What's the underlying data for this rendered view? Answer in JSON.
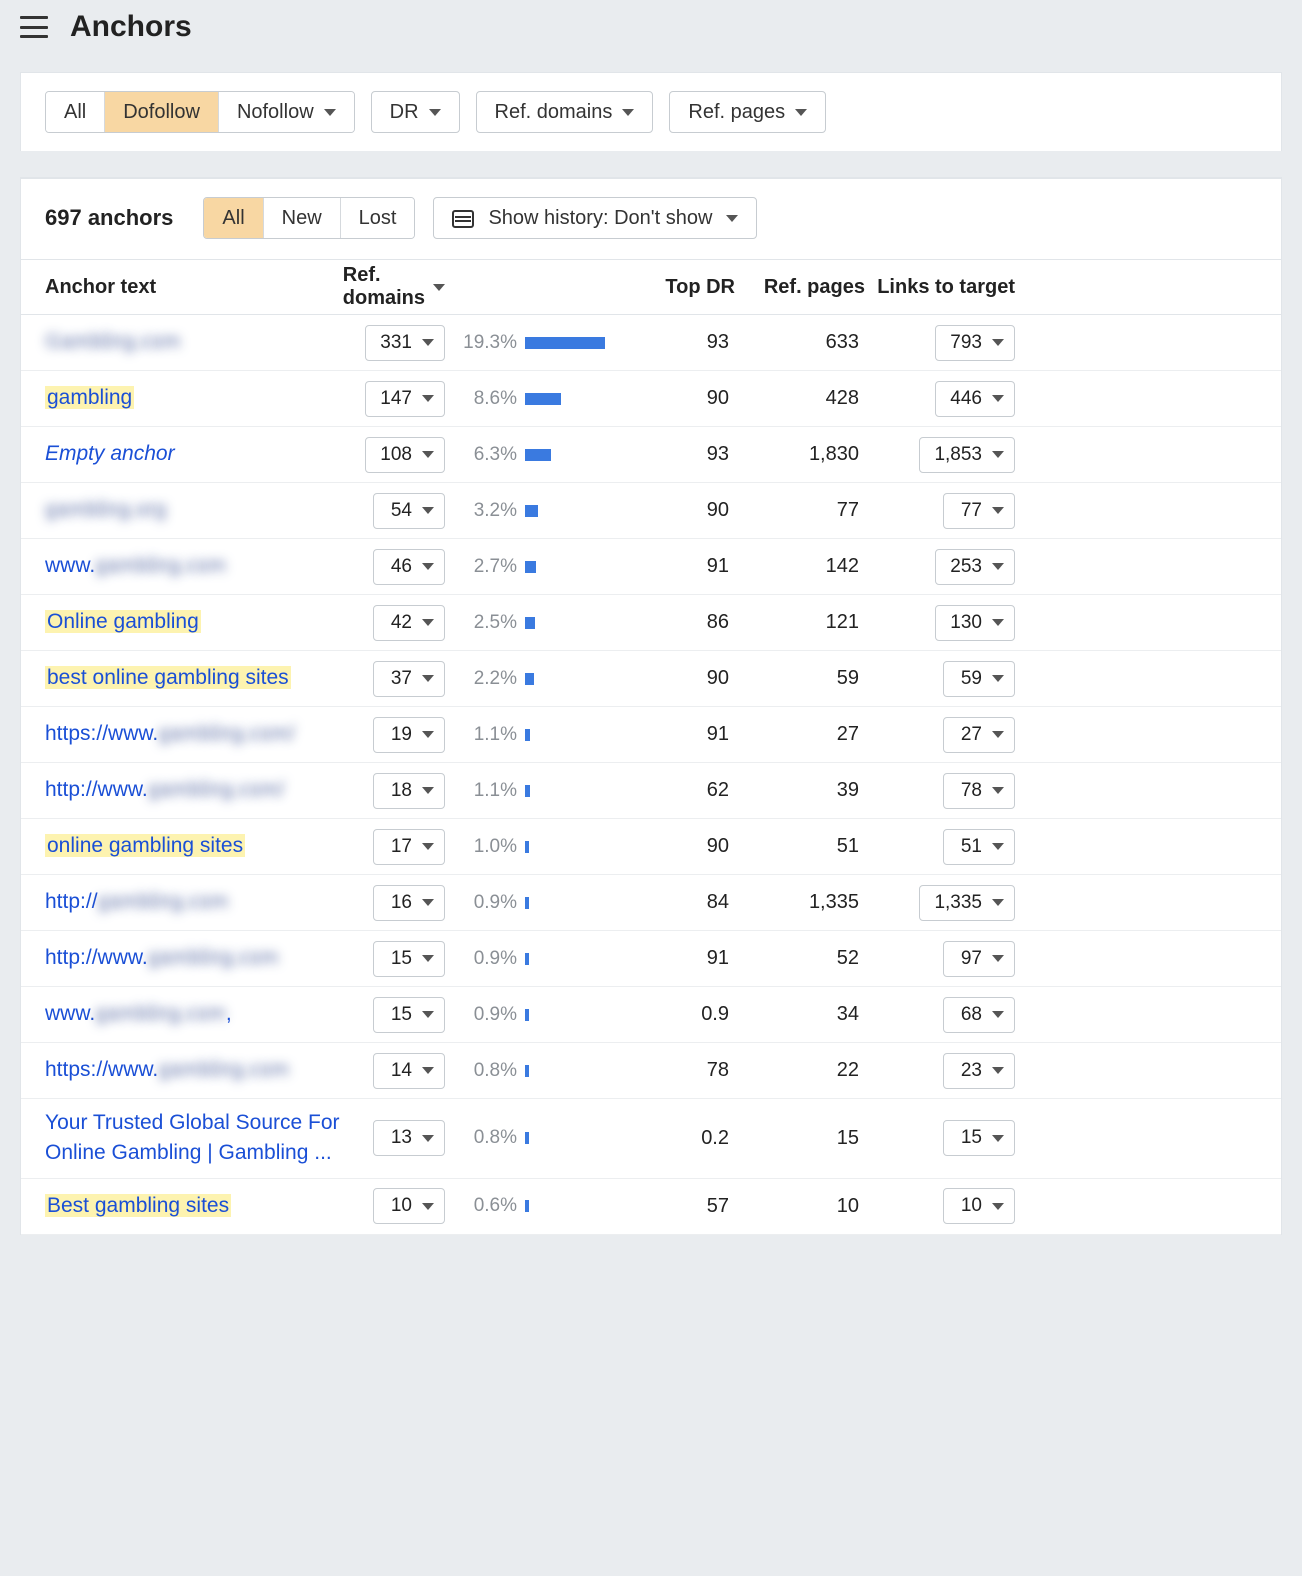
{
  "header": {
    "title": "Anchors"
  },
  "filters": {
    "follow": {
      "all": "All",
      "dofollow": "Dofollow",
      "nofollow": "Nofollow",
      "active": "dofollow"
    },
    "dr": "DR",
    "refdomains": "Ref. domains",
    "refpages": "Ref. pages"
  },
  "toolbar": {
    "count_text": "697 anchors",
    "group": {
      "all": "All",
      "new": "New",
      "lost": "Lost",
      "active": "all"
    },
    "history_label": "Show history: Don't show"
  },
  "columns": {
    "anchor": "Anchor text",
    "refdomains": "Ref. domains",
    "topdr": "Top DR",
    "refpages": "Ref. pages",
    "links": "Links to target"
  },
  "bar_max_pct": 19.3,
  "rows": [
    {
      "anchor": "Gambling.com",
      "highlight": false,
      "empty": false,
      "blurred": true,
      "ref_domains": "331",
      "pct": "19.3%",
      "bar_pct": 19.3,
      "top_dr": "93",
      "ref_pages": "633",
      "links": "793"
    },
    {
      "anchor": "gambling",
      "highlight": true,
      "empty": false,
      "blurred": false,
      "ref_domains": "147",
      "pct": "8.6%",
      "bar_pct": 8.6,
      "top_dr": "90",
      "ref_pages": "428",
      "links": "446"
    },
    {
      "anchor": "Empty anchor",
      "highlight": false,
      "empty": true,
      "blurred": false,
      "ref_domains": "108",
      "pct": "6.3%",
      "bar_pct": 6.3,
      "top_dr": "93",
      "ref_pages": "1,830",
      "links": "1,853"
    },
    {
      "anchor": "gambling.org",
      "highlight": false,
      "empty": false,
      "blurred": true,
      "ref_domains": "54",
      "pct": "3.2%",
      "bar_pct": 3.2,
      "top_dr": "90",
      "ref_pages": "77",
      "links": "77"
    },
    {
      "anchor_prefix": "www.",
      "anchor_blur": "gambling.com",
      "anchor": "www.gambling.com",
      "highlight": false,
      "empty": false,
      "blurred": false,
      "partial": true,
      "ref_domains": "46",
      "pct": "2.7%",
      "bar_pct": 2.7,
      "top_dr": "91",
      "ref_pages": "142",
      "links": "253"
    },
    {
      "anchor": "Online gambling",
      "highlight": true,
      "empty": false,
      "blurred": false,
      "ref_domains": "42",
      "pct": "2.5%",
      "bar_pct": 2.5,
      "top_dr": "86",
      "ref_pages": "121",
      "links": "130"
    },
    {
      "anchor": "best online gambling sites",
      "highlight": true,
      "empty": false,
      "blurred": false,
      "ref_domains": "37",
      "pct": "2.2%",
      "bar_pct": 2.2,
      "top_dr": "90",
      "ref_pages": "59",
      "links": "59"
    },
    {
      "anchor_prefix": "https://www.",
      "anchor_blur": "gambling.com/",
      "anchor": "https://www.gambling.com/",
      "highlight": false,
      "empty": false,
      "blurred": false,
      "partial": true,
      "ref_domains": "19",
      "pct": "1.1%",
      "bar_pct": 1.1,
      "top_dr": "91",
      "ref_pages": "27",
      "links": "27"
    },
    {
      "anchor_prefix": "http://www.",
      "anchor_blur": "gambling.com/",
      "anchor": "http://www.gambling.com/",
      "highlight": false,
      "empty": false,
      "blurred": false,
      "partial": true,
      "ref_domains": "18",
      "pct": "1.1%",
      "bar_pct": 1.1,
      "top_dr": "62",
      "ref_pages": "39",
      "links": "78"
    },
    {
      "anchor": "online gambling sites",
      "highlight": true,
      "empty": false,
      "blurred": false,
      "ref_domains": "17",
      "pct": "1.0%",
      "bar_pct": 1.0,
      "top_dr": "90",
      "ref_pages": "51",
      "links": "51"
    },
    {
      "anchor_prefix": "http://",
      "anchor_blur": "gambling.com",
      "anchor": "http://gambling.com",
      "highlight": false,
      "empty": false,
      "blurred": false,
      "partial": true,
      "ref_domains": "16",
      "pct": "0.9%",
      "bar_pct": 0.9,
      "top_dr": "84",
      "ref_pages": "1,335",
      "links": "1,335"
    },
    {
      "anchor_prefix": "http://www.",
      "anchor_blur": "gambling.com",
      "anchor": "http://www.gambling.com",
      "highlight": false,
      "empty": false,
      "blurred": false,
      "partial": true,
      "ref_domains": "15",
      "pct": "0.9%",
      "bar_pct": 0.9,
      "top_dr": "91",
      "ref_pages": "52",
      "links": "97"
    },
    {
      "anchor_prefix": "www.",
      "anchor_blur": "gambling.com",
      "anchor_suffix": ",",
      "anchor": "www.gambling.com,",
      "highlight": false,
      "empty": false,
      "blurred": false,
      "partial": true,
      "ref_domains": "15",
      "pct": "0.9%",
      "bar_pct": 0.9,
      "top_dr": "0.9",
      "ref_pages": "34",
      "links": "68"
    },
    {
      "anchor_prefix": "https://www.",
      "anchor_blur": "gambling.com",
      "anchor": "https://www.gambling.com",
      "highlight": false,
      "empty": false,
      "blurred": false,
      "partial": true,
      "ref_domains": "14",
      "pct": "0.8%",
      "bar_pct": 0.8,
      "top_dr": "78",
      "ref_pages": "22",
      "links": "23"
    },
    {
      "anchor": "Your Trusted Global Source For Online Gambling | Gambling ...",
      "highlight": false,
      "empty": false,
      "blurred": false,
      "ref_domains": "13",
      "pct": "0.8%",
      "bar_pct": 0.8,
      "top_dr": "0.2",
      "ref_pages": "15",
      "links": "15"
    },
    {
      "anchor": "Best gambling sites",
      "highlight": true,
      "empty": false,
      "blurred": false,
      "ref_domains": "10",
      "pct": "0.6%",
      "bar_pct": 0.6,
      "top_dr": "57",
      "ref_pages": "10",
      "links": "10"
    }
  ]
}
